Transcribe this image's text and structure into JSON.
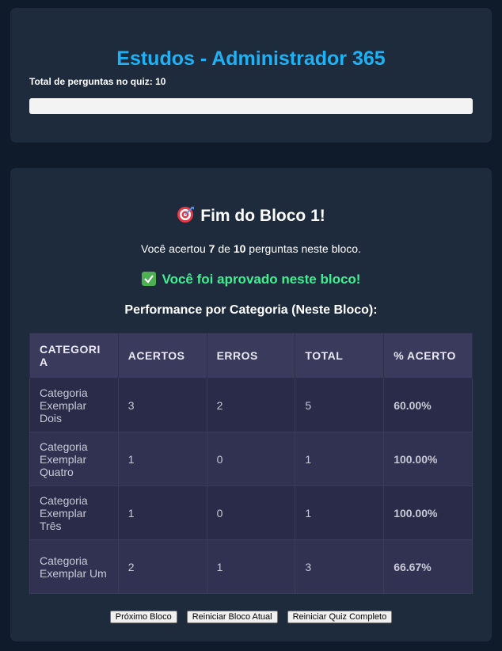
{
  "header": {
    "title": "Estudos - Administrador 365",
    "total_label": "Total de perguntas no quiz:",
    "total_value": "10",
    "progress_fraction": 0
  },
  "result": {
    "block_title": "Fim do Bloco 1!",
    "block_icon": "target-icon",
    "score": {
      "prefix": "Você acertou",
      "correct": "7",
      "middle": "de",
      "total": "10",
      "suffix": "perguntas neste bloco."
    },
    "approved_icon": "check-icon",
    "approved_text": "Você foi aprovado neste bloco!",
    "perf_heading": "Performance por Categoria (Neste Bloco):",
    "table": {
      "headers": [
        "CATEGORIA",
        "ACERTOS",
        "ERROS",
        "TOTAL",
        "% ACERTO"
      ],
      "rows": [
        [
          "Categoria Exemplar Dois",
          "3",
          "2",
          "5",
          "60.00%"
        ],
        [
          "Categoria Exemplar Quatro",
          "1",
          "0",
          "1",
          "100.00%"
        ],
        [
          "Categoria Exemplar Três",
          "1",
          "0",
          "1",
          "100.00%"
        ],
        [
          "Categoria Exemplar Um",
          "2",
          "1",
          "3",
          "66.67%"
        ]
      ]
    },
    "buttons": {
      "next": "Próximo Bloco",
      "restart_block": "Reiniciar Bloco Atual",
      "restart_quiz": "Reiniciar Quiz Completo"
    }
  },
  "colors": {
    "page_bg": "#0f1a2b",
    "card_bg": "#1e2b3d",
    "title_blue": "#1eb2f5",
    "approved_green": "#3ef08f",
    "table_header_bg": "#3a3b5c"
  }
}
